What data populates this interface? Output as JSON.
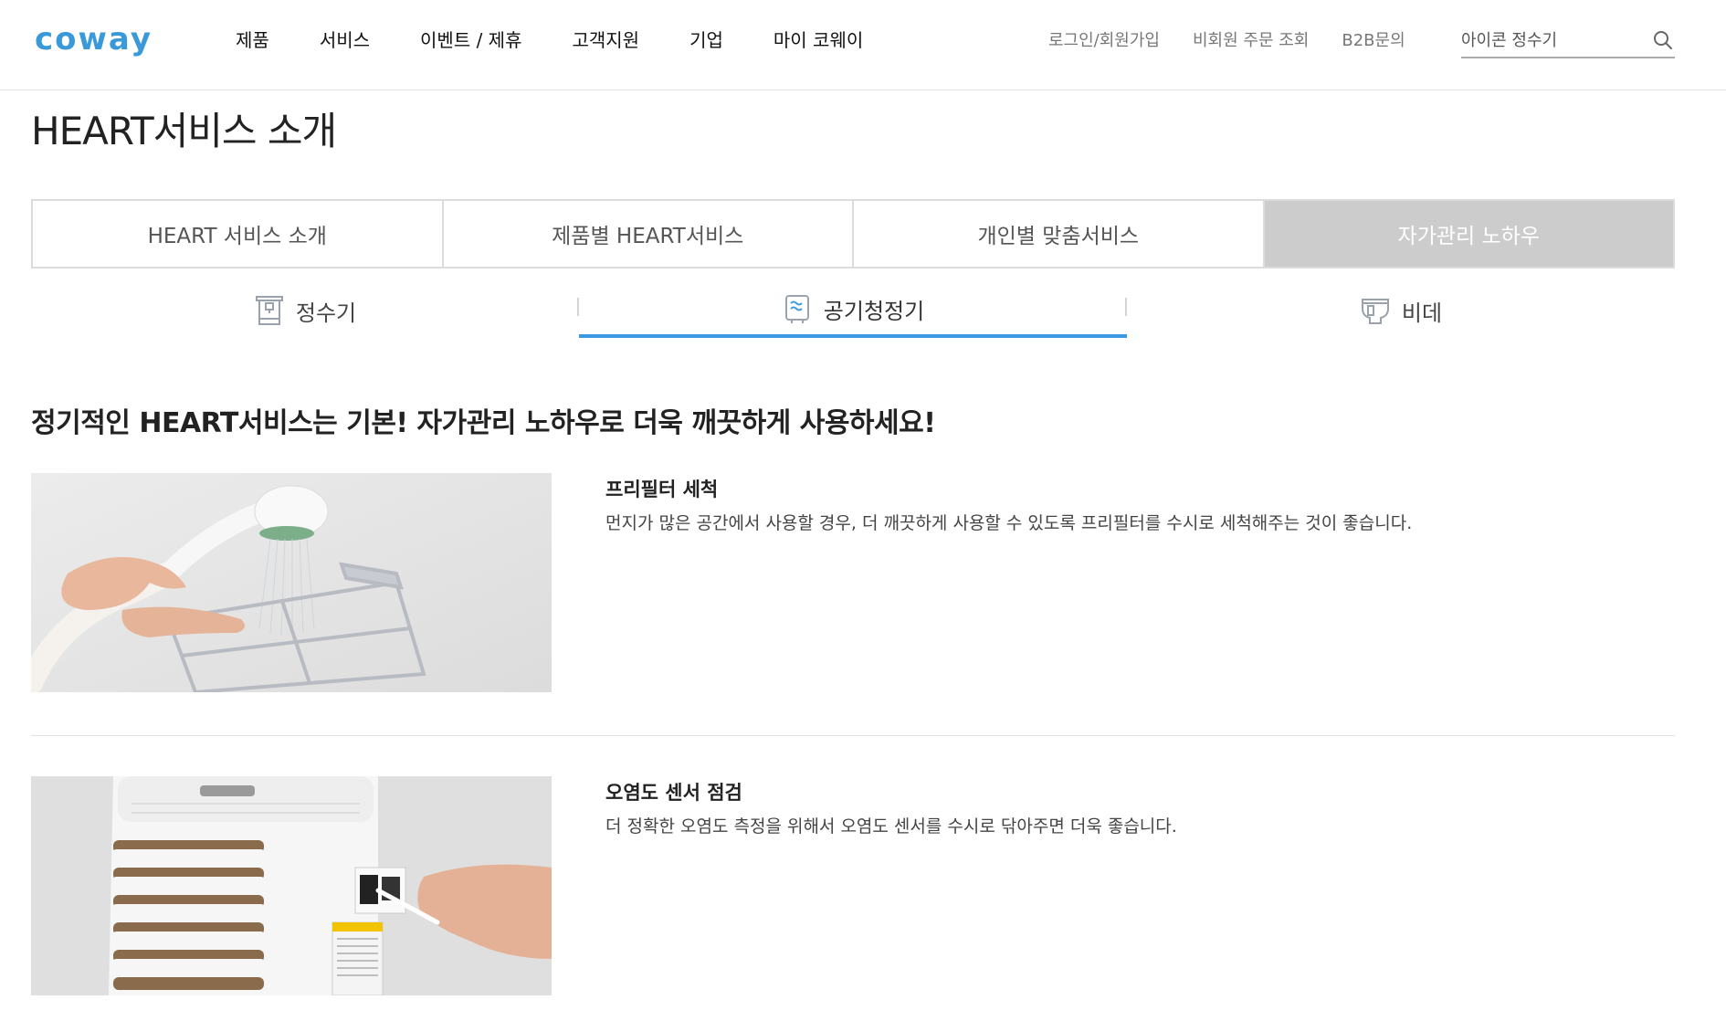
{
  "header": {
    "logo": "coway",
    "nav": [
      "제품",
      "서비스",
      "이벤트 / 제휴",
      "고객지원",
      "기업",
      "마이 코웨이"
    ],
    "util": [
      "로그인/회원가입",
      "비회원 주문 조회",
      "B2B문의"
    ],
    "search_placeholder": "아이콘 정수기"
  },
  "page_title": "HEART서비스 소개",
  "main_tabs": [
    {
      "label": "HEART 서비스 소개",
      "active": false
    },
    {
      "label": "제품별 HEART서비스",
      "active": false
    },
    {
      "label": "개인별 맞춤서비스",
      "active": false
    },
    {
      "label": "자가관리 노하우",
      "active": true
    }
  ],
  "sub_tabs": [
    {
      "label": "정수기",
      "icon": "water-purifier-icon",
      "active": false
    },
    {
      "label": "공기청정기",
      "icon": "air-purifier-icon",
      "active": true
    },
    {
      "label": "비데",
      "icon": "bidet-icon",
      "active": false
    }
  ],
  "intro": "정기적인 HEART서비스는 기본! 자가관리 노하우로 더욱 깨끗하게 사용하세요!",
  "items": [
    {
      "title": "프리필터 세척",
      "desc": "먼지가 많은 공간에서 사용할 경우, 더 깨끗하게 사용할 수 있도록 프리필터를 수시로 세척해주는 것이 좋습니다.",
      "image": "pre-filter-washing-photo"
    },
    {
      "title": "오염도 센서 점검",
      "desc": "더 정확한 오염도 측정을 위해서 오염도 센서를 수시로 닦아주면 더욱 좋습니다.",
      "image": "pollution-sensor-cleaning-photo"
    }
  ],
  "colors": {
    "brand": "#3a9ad9",
    "active_tab_bg": "#cccccc",
    "sub_tab_underline": "#3c9ae0"
  }
}
